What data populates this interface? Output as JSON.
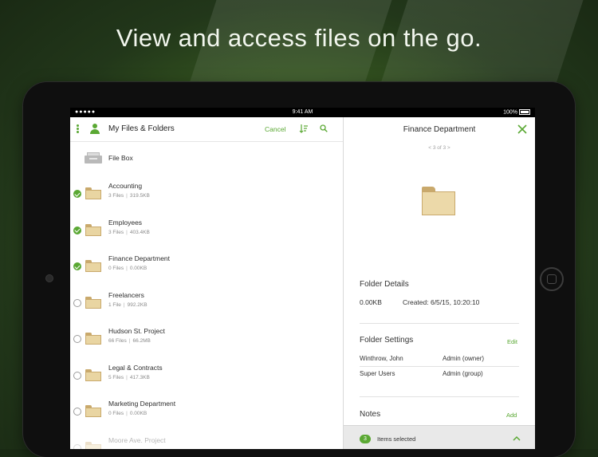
{
  "headline": "View and access files on the go.",
  "status": {
    "signal": "●●●●●",
    "time": "9:41 AM",
    "battery": "100%"
  },
  "left_pane": {
    "title": "My Files & Folders",
    "cancel_label": "Cancel",
    "file_box_label": "File Box",
    "items": [
      {
        "name": "Accounting",
        "files": "3 Files",
        "size": "319.5KB",
        "selected": true
      },
      {
        "name": "Employees",
        "files": "3 Files",
        "size": "403.4KB",
        "selected": true
      },
      {
        "name": "Finance Department",
        "files": "0 Files",
        "size": "0.00KB",
        "selected": true
      },
      {
        "name": "Freelancers",
        "files": "1 File",
        "size": "992.2KB",
        "selected": false
      },
      {
        "name": "Hudson St. Project",
        "files": "66 Files",
        "size": "66.2MB",
        "selected": false
      },
      {
        "name": "Legal & Contracts",
        "files": "5 Files",
        "size": "417.3KB",
        "selected": false
      },
      {
        "name": "Marketing Department",
        "files": "0 Files",
        "size": "0.00KB",
        "selected": false
      },
      {
        "name": "Moore Ave. Project",
        "files": "",
        "size": "",
        "selected": false
      }
    ]
  },
  "right_pane": {
    "title": "Finance Department",
    "pager": "<  3 of 3  >",
    "details_heading": "Folder Details",
    "size": "0.00KB",
    "created": "Created: 6/5/15, 10:20:10",
    "settings_heading": "Folder Settings",
    "edit_label": "Edit",
    "permissions": [
      {
        "user": "Winthrow, John",
        "role": "Admin (owner)"
      },
      {
        "user": "Super Users",
        "role": "Admin (group)"
      }
    ],
    "notes_heading": "Notes",
    "add_label": "Add",
    "selected_count": "3",
    "selected_label": "Items selected"
  },
  "colors": {
    "accent": "#5aa833",
    "folder": "#e9d5a2"
  },
  "icons": [
    "kebab-menu-icon",
    "user-icon",
    "sort-icon",
    "search-icon",
    "close-icon",
    "folder-icon",
    "file-box-icon",
    "chevron-up-icon",
    "checkmark-icon"
  ]
}
